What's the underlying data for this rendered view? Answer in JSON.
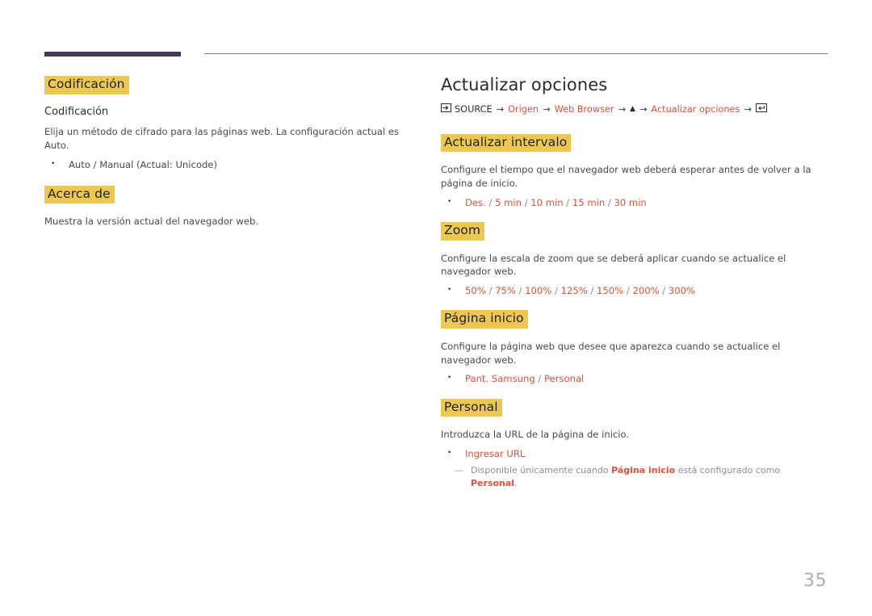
{
  "page": {
    "number": "35"
  },
  "left_column": {
    "sections": [
      {
        "heading": "Codificación",
        "sub_heading": "Codificación",
        "body": "Elija un método de cifrado para las páginas web. La configuración actual es Auto.",
        "bullet": "Auto / Manual (Actual: Unicode)",
        "bullet_mark": "•"
      },
      {
        "heading": "Acerca de",
        "body": "Muestra la versión actual del navegador web."
      }
    ]
  },
  "right_column": {
    "title": "Actualizar opciones",
    "breadcrumb": {
      "source_icon": "source-input-icon",
      "source_label": "SOURCE",
      "arrow": "→",
      "item_origen": "Origen",
      "item_web_browser": "Web Browser",
      "up_arrow": "▲",
      "item_actualizar": "Actualizar opciones",
      "enter_icon": "enter-key-icon"
    },
    "sections": [
      {
        "heading": "Actualizar intervalo",
        "body": "Configure el tiempo que el navegador web deberá esperar antes de volver a la página de inicio.",
        "bullet_mark": "•",
        "options": [
          "Des.",
          "5 min",
          "10 min",
          "15 min",
          "30 min"
        ],
        "option_separator": "/"
      },
      {
        "heading": "Zoom",
        "body": "Configure la escala de zoom que se deberá aplicar cuando se actualice el navegador web.",
        "bullet_mark": "•",
        "options": [
          "50%",
          "75%",
          "100%",
          "125%",
          "150%",
          "200%",
          "300%"
        ],
        "option_separator": "/"
      },
      {
        "heading": "Página inicio",
        "body": "Configure la página web que desee que aparezca cuando se actualice el navegador web.",
        "bullet_mark": "•",
        "options": [
          "Pant. Samsung",
          "Personal"
        ],
        "option_separator": "/"
      },
      {
        "heading": "Personal",
        "body": "Introduzca la URL de la página de inicio.",
        "bullet_mark": "•",
        "options": [
          "Ingresar URL"
        ],
        "option_separator": "/",
        "note": {
          "mark": "―",
          "prefix": "Disponible únicamente cuando ",
          "bold1": "Página inicio",
          "middle": " está configurado como ",
          "bold2": "Personal",
          "suffix": "."
        }
      }
    ]
  },
  "colors": {
    "highlight": "#edc850",
    "accent_red": "#dd5139",
    "rule_dark": "#463b54",
    "page_number": "#a9adbd"
  }
}
